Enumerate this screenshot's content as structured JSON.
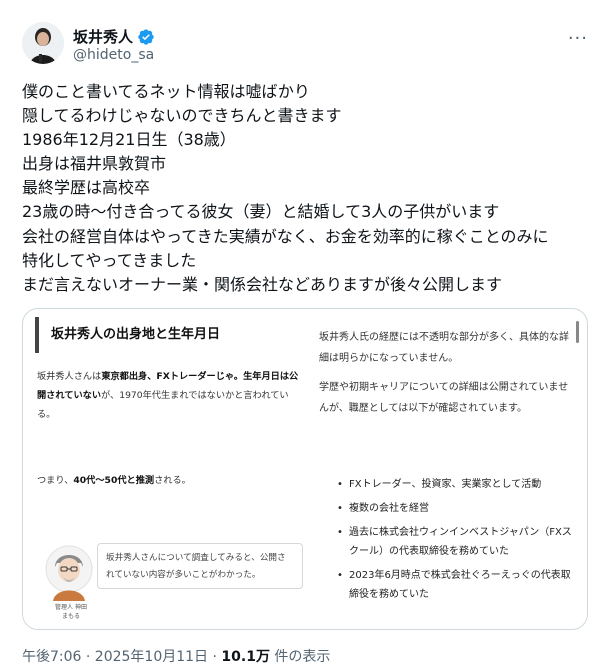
{
  "author": {
    "display_name": "坂井秀人",
    "handle": "@hideto_sa",
    "verified": true,
    "verified_color": "#1d9bf0"
  },
  "more_icon": "more-dots-icon",
  "tweet": {
    "lines": [
      "僕のこと書いてるネット情報は嘘ばかり",
      "隠してるわけじゃないのできちんと書きます",
      "1986年12月21日生（38歳）",
      "出身は福井県敦賀市",
      "最終学歴は高校卒",
      "23歳の時〜付き合ってる彼女（妻）と結婚して3人の子供がいます",
      "会社の経営自体はやってきた実績がなく、お金を効率的に稼ぐことのみに",
      "特化してやってきました",
      "まだ言えないオーナー業・関係会社などありますが後々公開します"
    ]
  },
  "media": {
    "left": {
      "heading": "坂井秀人の出身地と生年月日",
      "para1_a": "坂井秀人さんは",
      "para1_b": "東京都出身、FXトレーダーじゃ。生年月日は公開されていない",
      "para1_c": "が、1970年代生まれではないかと言われている。",
      "para2_a": "つまり、",
      "para2_b": "40代〜50代と推測",
      "para2_c": "される。",
      "bubble": "坂井秀人さんについて調査してみると、公開されていない内容が多いことがわかった。",
      "caption_line1": "管理人 神田",
      "caption_line2": "まもる"
    },
    "right": {
      "para1": "坂井秀人氏の経歴には不透明な部分が多く、具体的な詳細は明らかになっていません。",
      "para2": "学歴や初期キャリアについての詳細は公開されていませんが、職歴としては以下が確認されています。",
      "bullets": [
        "FXトレーダー、投資家、実業家として活動",
        "複数の会社を経営",
        "過去に株式会社ウィンインベストジャパン（FXスクール）の代表取締役を務めていた",
        "2023年6月時点で株式会社ぐろーえっぐの代表取締役を務めていた"
      ]
    }
  },
  "meta": {
    "time": "午後7:06 · 2025年10月11日 · ",
    "views": "10.1万",
    "views_suffix": " 件の表示"
  }
}
